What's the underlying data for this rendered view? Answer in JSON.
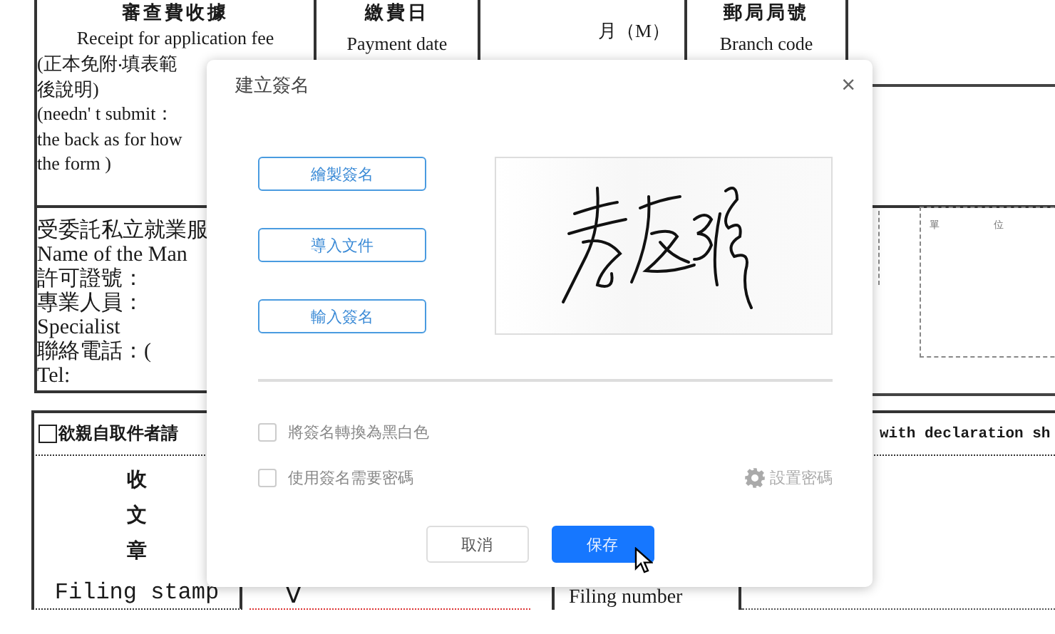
{
  "document": {
    "fee_cell": {
      "title": "審查費收據",
      "subtitle": "Receipt for application fee",
      "lines": [
        "(正本免附‧填表範",
        "後說明)",
        "(needn' t submit：",
        "the back as for how",
        "the form )"
      ]
    },
    "payment_cell": {
      "title": "繳費日",
      "subtitle": "Payment date"
    },
    "month_cell": {
      "label": "月（M）"
    },
    "branch_cell": {
      "title": "郵局局號",
      "subtitle": "Branch code"
    },
    "agency_lines": [
      "受委託私立就業服",
      "Name of the Man",
      "許可證號：",
      "專業人員：",
      "Specialist",
      "聯絡電話：(",
      "Tel:"
    ],
    "stamp_box": {
      "labels": [
        "單",
        "位"
      ]
    },
    "pickup": {
      "label": "欲親自取件者請",
      "checked": false,
      "declaration": "with declaration sh"
    },
    "filing_stamp": {
      "chars": [
        "收",
        "文",
        "章"
      ],
      "label": "Filing stamp"
    },
    "mark": "V",
    "filing_number": "Filing number"
  },
  "dialog": {
    "title": "建立簽名",
    "close": "×",
    "actions": [
      "繪製簽名",
      "導入文件",
      "輸入簽名"
    ],
    "options": [
      {
        "label": "將簽名轉換為黑白色",
        "checked": false
      },
      {
        "label": "使用簽名需要密碼",
        "checked": false
      }
    ],
    "set_password": {
      "label": "設置密碼",
      "disabled": true
    },
    "buttons": [
      {
        "label": "取消",
        "kind": "secondary"
      },
      {
        "label": "保存",
        "kind": "primary"
      }
    ]
  }
}
